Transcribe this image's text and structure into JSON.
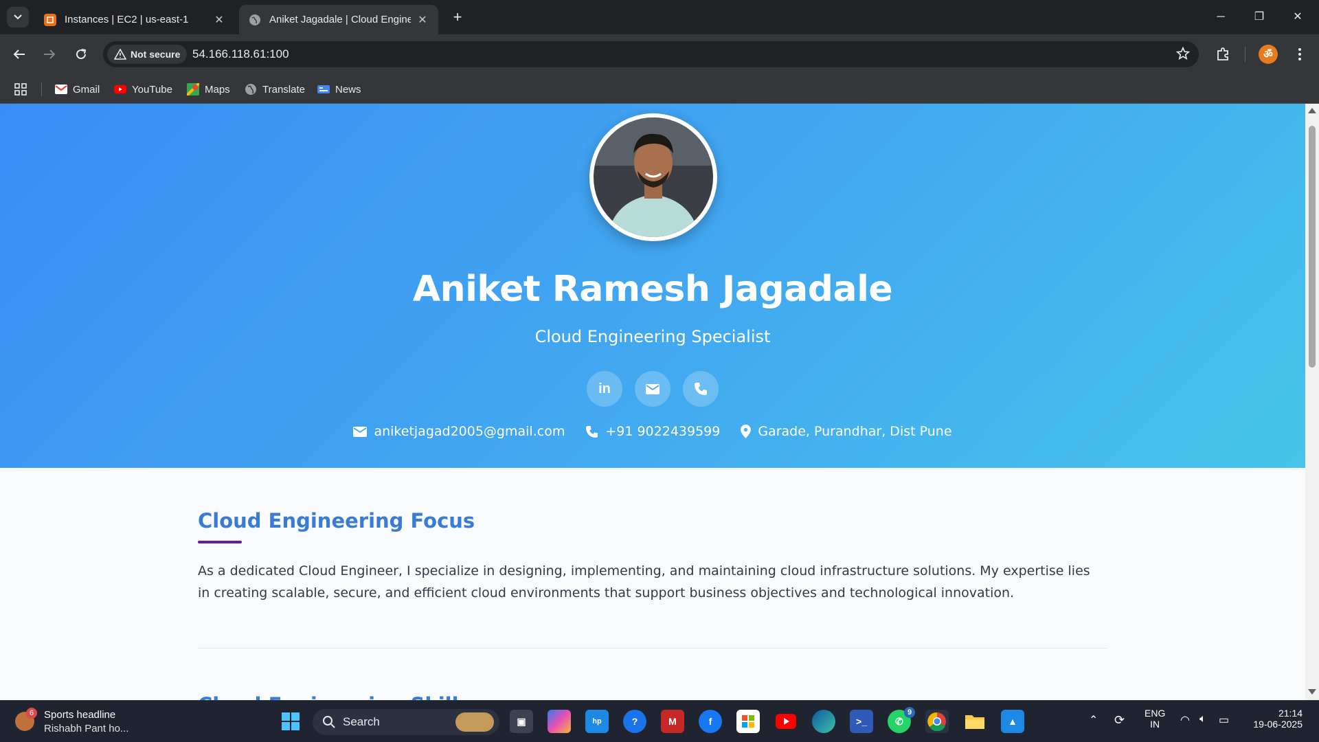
{
  "browser": {
    "tabs": [
      {
        "title": "Instances | EC2 | us-east-1",
        "active": false
      },
      {
        "title": "Aniket Jagadale | Cloud Engineer",
        "active": true
      }
    ],
    "security_label": "Not secure",
    "url": "54.166.118.61:100",
    "bookmarks": [
      {
        "label": "Gmail",
        "icon": "gmail-icon"
      },
      {
        "label": "YouTube",
        "icon": "youtube-icon"
      },
      {
        "label": "Maps",
        "icon": "maps-icon"
      },
      {
        "label": "Translate",
        "icon": "translate-icon"
      },
      {
        "label": "News",
        "icon": "news-icon"
      }
    ]
  },
  "profile": {
    "name": "Aniket Ramesh Jagadale",
    "subtitle": "Cloud Engineering Specialist",
    "social": [
      {
        "icon": "linkedin-icon",
        "glyph": "in"
      },
      {
        "icon": "email-icon"
      },
      {
        "icon": "phone-icon"
      }
    ],
    "email": "aniketjagad2005@gmail.com",
    "phone": "+91 9022439599",
    "location": "Garade, Purandhar, Dist Pune"
  },
  "about": {
    "heading": "Cloud Engineering Focus",
    "body": "As a dedicated Cloud Engineer, I specialize in designing, implementing, and maintaining cloud infrastructure solutions. My expertise lies in creating scalable, secure, and efficient cloud environments that support business objectives and technological innovation."
  },
  "next_section": {
    "heading": "Cloud Engineering Skills"
  },
  "taskbar": {
    "news_badge": "6",
    "news_title": "Sports headline",
    "news_text": "Rishabh Pant ho...",
    "search_label": "Search",
    "whatsapp_badge": "9",
    "lang_top": "ENG",
    "lang_bottom": "IN",
    "time": "21:14",
    "date": "19-06-2025"
  },
  "colors": {
    "hero_start": "#3b8df5",
    "hero_end": "#47c4ea",
    "heading_blue": "#3a7bd5",
    "underline_purple": "#6a1b9a"
  }
}
